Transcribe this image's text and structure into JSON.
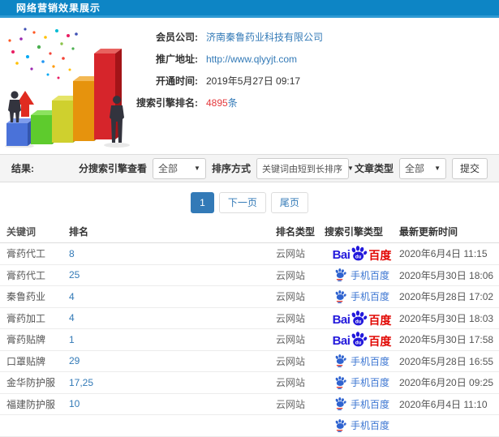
{
  "header": {
    "title": "网络营销效果展示"
  },
  "info": {
    "rows": [
      {
        "label": "会员公司:",
        "value": "济南秦鲁药业科技有限公司"
      },
      {
        "label": "推广地址:",
        "value": "http://www.qlyyjt.com"
      },
      {
        "label": "开通时间:",
        "value": "2019年5月27日 09:17"
      },
      {
        "label": "搜索引擎排名:",
        "value": "4895",
        "suffix": "条"
      }
    ]
  },
  "filters": {
    "section_label": "结果:",
    "engine_filter_label": "分搜索引擎查看",
    "engine_filter_value": "全部",
    "sort_label": "排序方式",
    "sort_value": "关键词由短到长排序",
    "article_type_label": "文章类型",
    "article_type_value": "全部",
    "submit_label": "提交",
    "caret": "▼"
  },
  "pagination": {
    "current": "1",
    "next_label": "下一页",
    "last_label": "尾页"
  },
  "table": {
    "headers": [
      "关键词",
      "排名",
      "排名类型",
      "搜索引擎类型",
      "最新更新时间"
    ],
    "engine_logos": {
      "baidu_pc": {
        "text_latin": "Bai",
        "text_paw": "du",
        "text_cn": "百度"
      },
      "baidu_mobile": {
        "label": "手机百度"
      }
    },
    "rows": [
      {
        "keyword": "膏药代工",
        "rank": "8",
        "rank_type": "云网站",
        "engine": "baidu-pc",
        "updated": "2020年6月4日 11:15"
      },
      {
        "keyword": "膏药代工",
        "rank": "25",
        "rank_type": "云网站",
        "engine": "baidu-mobile",
        "updated": "2020年5月30日 18:06"
      },
      {
        "keyword": "秦鲁药业",
        "rank": "4",
        "rank_type": "云网站",
        "engine": "baidu-mobile",
        "updated": "2020年5月28日 17:02"
      },
      {
        "keyword": "膏药加工",
        "rank": "4",
        "rank_type": "云网站",
        "engine": "baidu-pc",
        "updated": "2020年5月30日 18:03"
      },
      {
        "keyword": "膏药贴牌",
        "rank": "1",
        "rank_type": "云网站",
        "engine": "baidu-pc",
        "updated": "2020年5月30日 17:58"
      },
      {
        "keyword": "口罩贴牌",
        "rank": "29",
        "rank_type": "云网站",
        "engine": "baidu-mobile",
        "updated": "2020年5月28日 16:55"
      },
      {
        "keyword": "金华防护服",
        "rank": "17,25",
        "rank_type": "云网站",
        "engine": "baidu-mobile",
        "updated": "2020年6月20日 09:25"
      },
      {
        "keyword": "福建防护服",
        "rank": "10",
        "rank_type": "云网站",
        "engine": "baidu-mobile",
        "updated": "2020年6月4日 11:10"
      },
      {
        "keyword": "",
        "rank": "",
        "rank_type": "",
        "engine": "baidu-mobile",
        "updated": "",
        "partial": true
      }
    ]
  },
  "colors": {
    "header_bar": "#0d85c5",
    "link_blue": "#337ab7",
    "count_red": "#e4393c",
    "baidu_blue": "#2319dc",
    "baidu_red": "#e10602",
    "mobile_baidu_blue": "#3c76d2",
    "pagination_active": "#337ab7",
    "filter_bar_bg": "#f4f4f4"
  }
}
